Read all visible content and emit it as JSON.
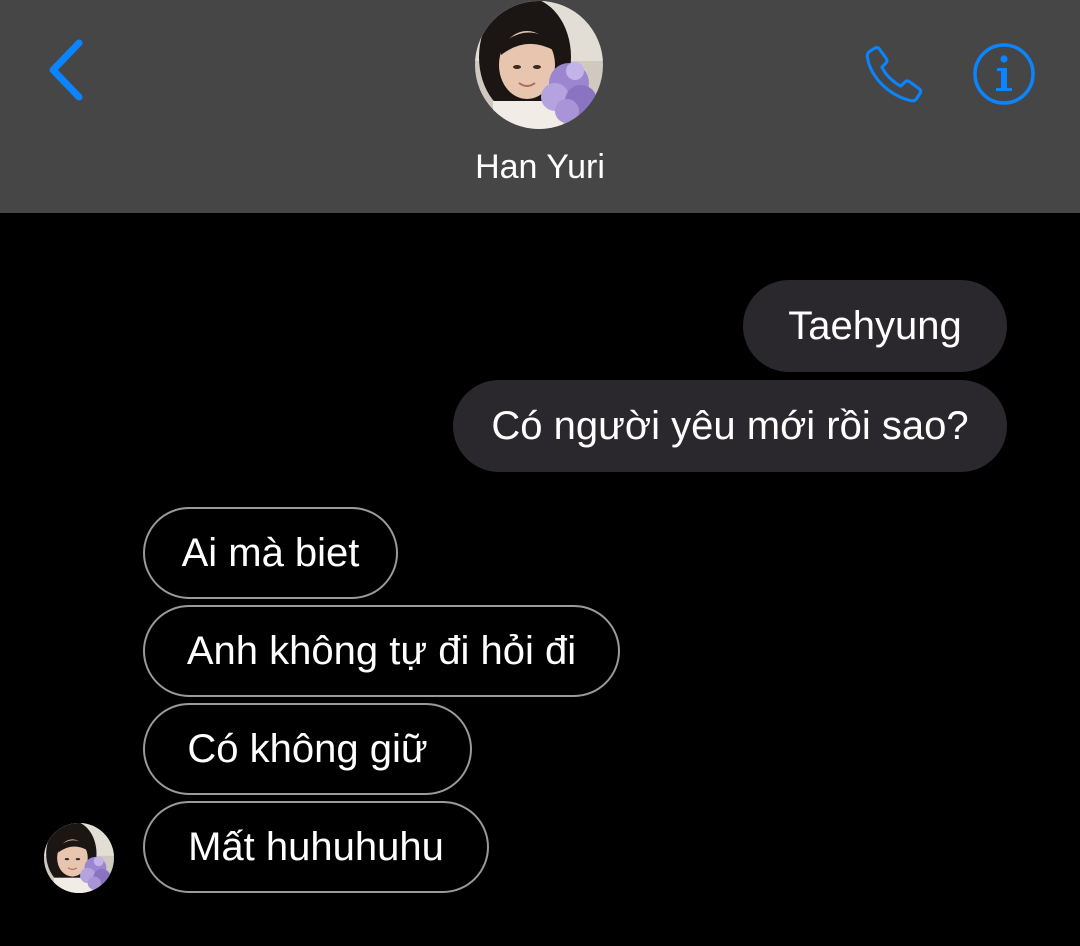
{
  "header": {
    "contact_name": "Han Yuri",
    "back_icon": "chevron-left-icon",
    "call_icon": "phone-icon",
    "info_icon": "info-icon",
    "avatar_icon": "contact-avatar",
    "accent_color": "#0a84ff"
  },
  "conversation": {
    "outgoing": [
      {
        "text": "Taehyung"
      },
      {
        "text": "Có người yêu mới rồi sao?"
      }
    ],
    "incoming": [
      {
        "text": "Ai mà biet"
      },
      {
        "text": "Anh không tự đi hỏi đi"
      },
      {
        "text": "Có không giữ"
      },
      {
        "text": "Mất huhuhuhu"
      }
    ]
  },
  "colors": {
    "header_bg": "#464646",
    "screen_bg": "#000000",
    "outgoing_bubble": "#2a272d",
    "incoming_border": "#9a9a9a"
  }
}
